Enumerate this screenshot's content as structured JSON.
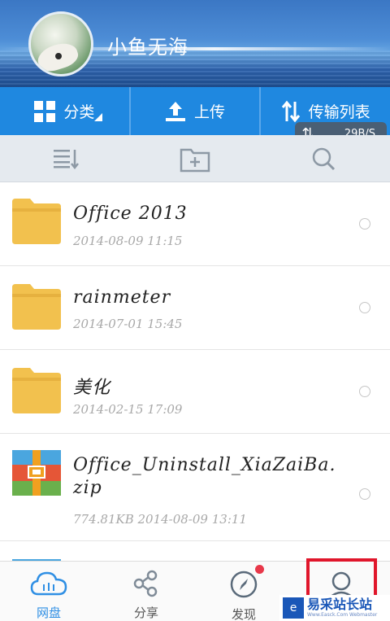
{
  "profile": {
    "username": "小鱼无海"
  },
  "actions": {
    "category_label": "分类",
    "upload_label": "上传",
    "transfer_label": "传输列表",
    "speed": "29B/S"
  },
  "files": [
    {
      "name": "Office 2013",
      "meta": "2014-08-09  11:15",
      "type": "folder"
    },
    {
      "name": "rainmeter",
      "meta": "2014-07-01  15:45",
      "type": "folder"
    },
    {
      "name": "美化",
      "meta": "2014-02-15  17:09",
      "type": "folder"
    },
    {
      "name": "Office_Uninstall_XiaZaiBa.",
      "name2": "zip",
      "meta": "774.81KB  2014-08-09  13:11",
      "type": "archive"
    }
  ],
  "bottom_nav": {
    "items": [
      {
        "label": "网盘",
        "icon": "cloud-icon"
      },
      {
        "label": "分享",
        "icon": "share-icon"
      },
      {
        "label": "发现",
        "icon": "compass-icon"
      },
      {
        "label": "",
        "icon": "user-icon"
      }
    ]
  },
  "watermark": {
    "text": "易采站长站",
    "sub": "Www.Easck.Com Webmaster"
  },
  "colors": {
    "accent": "#1f88e0",
    "folder": "#f2c14e",
    "badge": "#e8384a",
    "highlight": "#e0162b"
  }
}
